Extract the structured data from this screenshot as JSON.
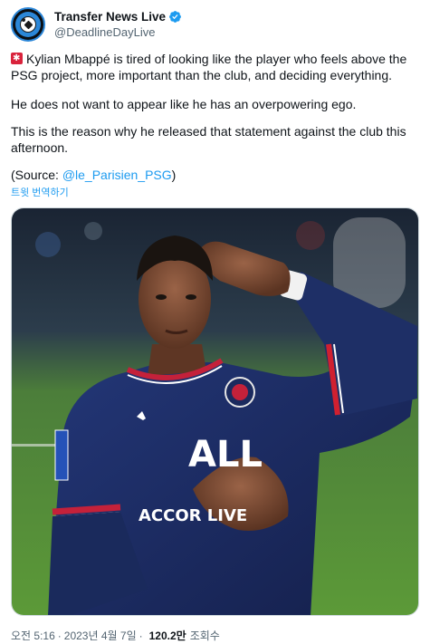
{
  "author": {
    "display_name": "Transfer News Live",
    "handle": "@DeadlineDayLive",
    "avatar_icon": "soccer-ball-icon",
    "verified_icon": "verified-badge-icon",
    "verified_color": "#1d9bf0"
  },
  "tweet": {
    "flag_icon": "red-alert-flag-icon",
    "para1": "Kylian Mbappé is tired of looking like the player who feels above the PSG project, more important than the club, and deciding everything.",
    "para2": "He does not want to appear like he has an overpowering ego.",
    "para3": "This is the reason why he released that statement against the club this afternoon.",
    "source_prefix": "(Source: ",
    "source_mention": "@le_Parisien_PSG",
    "source_suffix": ")",
    "translate_label": "트윗 번역하기"
  },
  "media": {
    "description_icon": "player-saluting-photo",
    "sponsor_line1": "ALL",
    "sponsor_line2": "ACCOR LIVE"
  },
  "meta": {
    "time": "오전 5:16",
    "date": "2023년 4월 7일",
    "views_count": "120.2만",
    "views_label": "조회수",
    "separator": "·"
  },
  "colors": {
    "link": "#1d9bf0",
    "secondary_text": "#536471",
    "primary_text": "#0f1419",
    "psg_navy": "#1b2a5e",
    "pitch_green": "#4f8a2e"
  }
}
